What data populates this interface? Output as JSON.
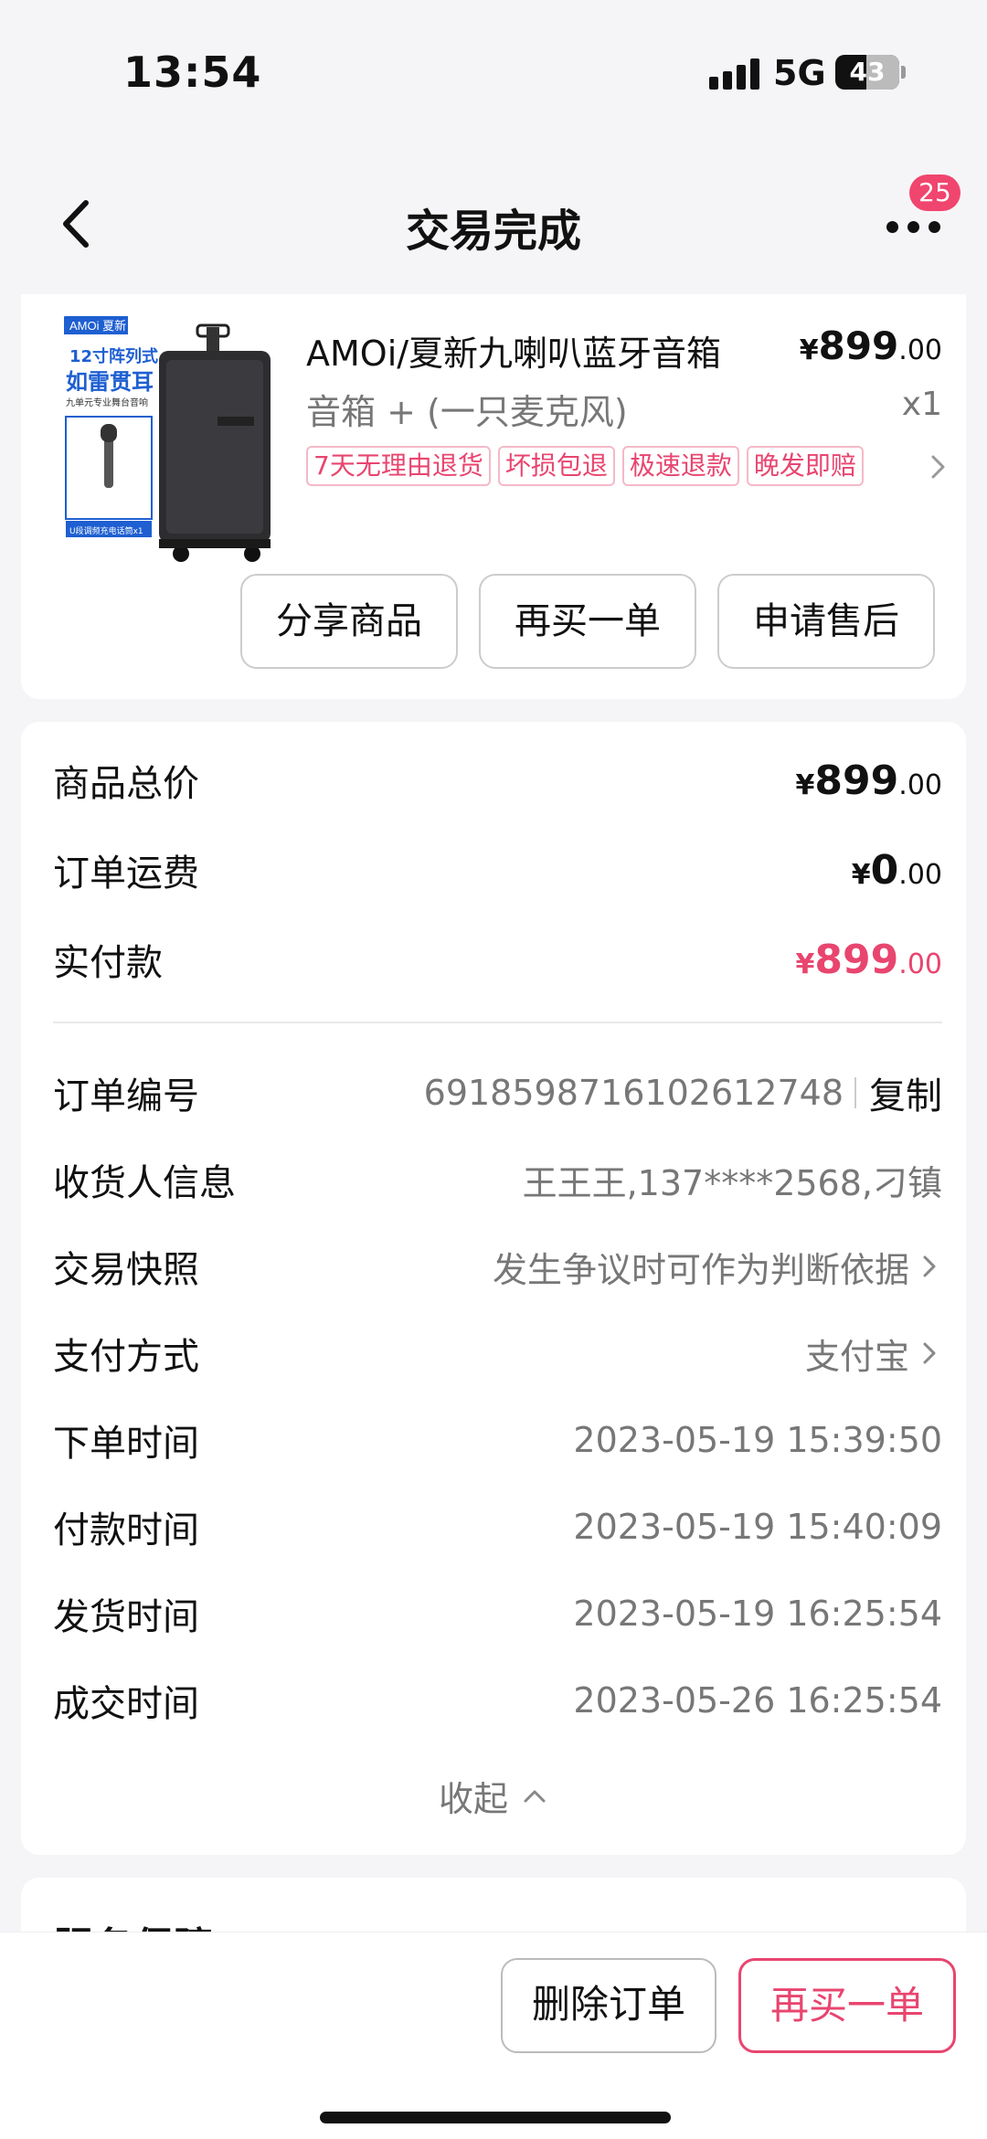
{
  "status": {
    "time": "13:54",
    "network": "5G",
    "battery": "43"
  },
  "header": {
    "title": "交易完成",
    "badge": "25"
  },
  "product": {
    "title": "AMOi/夏新九喇叭蓝牙音箱",
    "subtitle": "音箱 + (一只麦克风)",
    "price_currency": "¥",
    "price_int": "899",
    "price_dec": ".00",
    "quantity": "x1",
    "tags": [
      "7天无理由退货",
      "坏损包退",
      "极速退款",
      "晚发即赔"
    ],
    "thumb": {
      "brand": "AMOi 夏新",
      "line1": "12寸阵列式",
      "line2": "如雷贯耳",
      "line3": "九单元专业舞台音响",
      "line4": "U段调频充电话筒x1"
    },
    "buttons": {
      "share": "分享商品",
      "rebuy": "再买一单",
      "aftersale": "申请售后"
    }
  },
  "summary": {
    "total": {
      "label": "商品总价",
      "cur": "¥",
      "int": "899",
      "dec": ".00"
    },
    "shipping": {
      "label": "订单运费",
      "cur": "¥",
      "int": "0",
      "dec": ".00"
    },
    "paid": {
      "label": "实付款",
      "cur": "¥",
      "int": "899",
      "dec": ".00"
    }
  },
  "info": {
    "order_no": {
      "label": "订单编号",
      "value": "6918598716102612748",
      "copy": "复制"
    },
    "receiver": {
      "label": "收货人信息",
      "value": "王王王,137****2568,刁镇"
    },
    "snapshot": {
      "label": "交易快照",
      "value": "发生争议时可作为判断依据"
    },
    "payment": {
      "label": "支付方式",
      "value": "支付宝"
    },
    "order_time": {
      "label": "下单时间",
      "value": "2023-05-19 15:39:50"
    },
    "pay_time": {
      "label": "付款时间",
      "value": "2023-05-19 15:40:09"
    },
    "ship_time": {
      "label": "发货时间",
      "value": "2023-05-19 16:25:54"
    },
    "deal_time": {
      "label": "成交时间",
      "value": "2023-05-26 16:25:54"
    },
    "collapse": "收起"
  },
  "service": {
    "title": "服务保障"
  },
  "bottom": {
    "delete": "删除订单",
    "rebuy": "再买一单"
  },
  "colors": {
    "accent": "#e8456f",
    "badge": "#f0456e",
    "tag_border": "#f5b9c8"
  }
}
